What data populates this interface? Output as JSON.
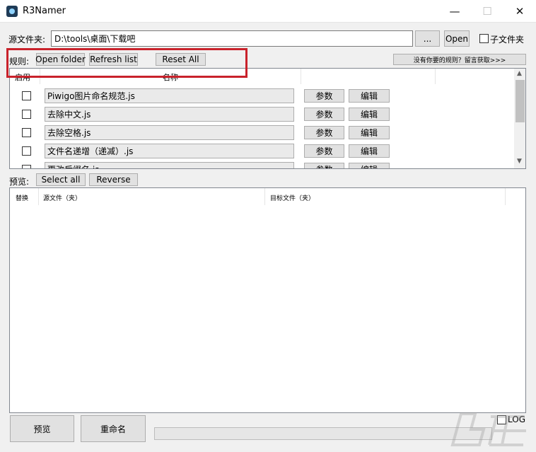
{
  "window": {
    "title": "R3Namer",
    "minimize": "—",
    "maximize": "☐",
    "close": "✕"
  },
  "source": {
    "label": "源文件夹:",
    "path": "D:\\tools\\桌面\\下载吧",
    "browse_label": "...",
    "open_label": "Open",
    "subfolder_label": "子文件夹"
  },
  "rules": {
    "label": "规则:",
    "open_folder_label": "Open folder",
    "refresh_label": "Refresh list",
    "reset_label": "Reset All",
    "get_more_label": "没有你要的规则？留言获取>>>",
    "col_enabled": "启用",
    "col_name": "名称",
    "items": [
      {
        "name": "Piwigo图片命名规范.js",
        "params": "参数",
        "edit": "编辑"
      },
      {
        "name": "去除中文.js",
        "params": "参数",
        "edit": "编辑"
      },
      {
        "name": "去除空格.js",
        "params": "参数",
        "edit": "编辑"
      },
      {
        "name": "文件名递增（递减）.js",
        "params": "参数",
        "edit": "编辑"
      },
      {
        "name": "更改后缀名.js",
        "params": "参数",
        "edit": "编辑"
      }
    ]
  },
  "preview": {
    "label": "预览:",
    "select_all_label": "Select all",
    "reverse_label": "Reverse",
    "col_replace": "替换",
    "col_source": "源文件（夹）",
    "col_target": "目标文件（夹）"
  },
  "actions": {
    "preview_label": "预览",
    "rename_label": "重命名",
    "log_label": "LOG"
  },
  "colors": {
    "highlight": "#c9222b",
    "panel_border": "#828790"
  }
}
